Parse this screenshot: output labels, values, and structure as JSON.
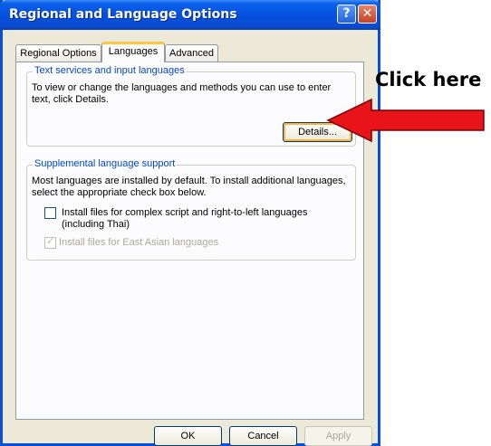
{
  "window": {
    "title": "Regional and Language Options",
    "help_glyph": "?",
    "close_glyph": "✕"
  },
  "tabs": [
    {
      "label": "Regional Options",
      "selected": false
    },
    {
      "label": "Languages",
      "selected": true
    },
    {
      "label": "Advanced",
      "selected": false
    }
  ],
  "text_services": {
    "group_title": "Text services and input languages",
    "description": "To view or change the languages and methods you can use to enter text, click Details.",
    "details_button": "Details..."
  },
  "supplemental": {
    "group_title": "Supplemental language support",
    "description": "Most languages are installed by default. To install additional languages, select the appropriate check box below.",
    "complex_script": {
      "label": "Install files for complex script and right-to-left languages (including Thai)",
      "checked": false,
      "enabled": true
    },
    "east_asian": {
      "label": "Install files for East Asian languages",
      "checked": true,
      "enabled": false
    }
  },
  "footer": {
    "ok": "OK",
    "cancel": "Cancel",
    "apply": "Apply"
  },
  "annotation": {
    "text": "Click here",
    "arrow_color": "#e8141a"
  },
  "colors": {
    "titlebar": "#0550dc",
    "group_title": "#0046d5",
    "tab_highlight": "#ffc83c"
  }
}
